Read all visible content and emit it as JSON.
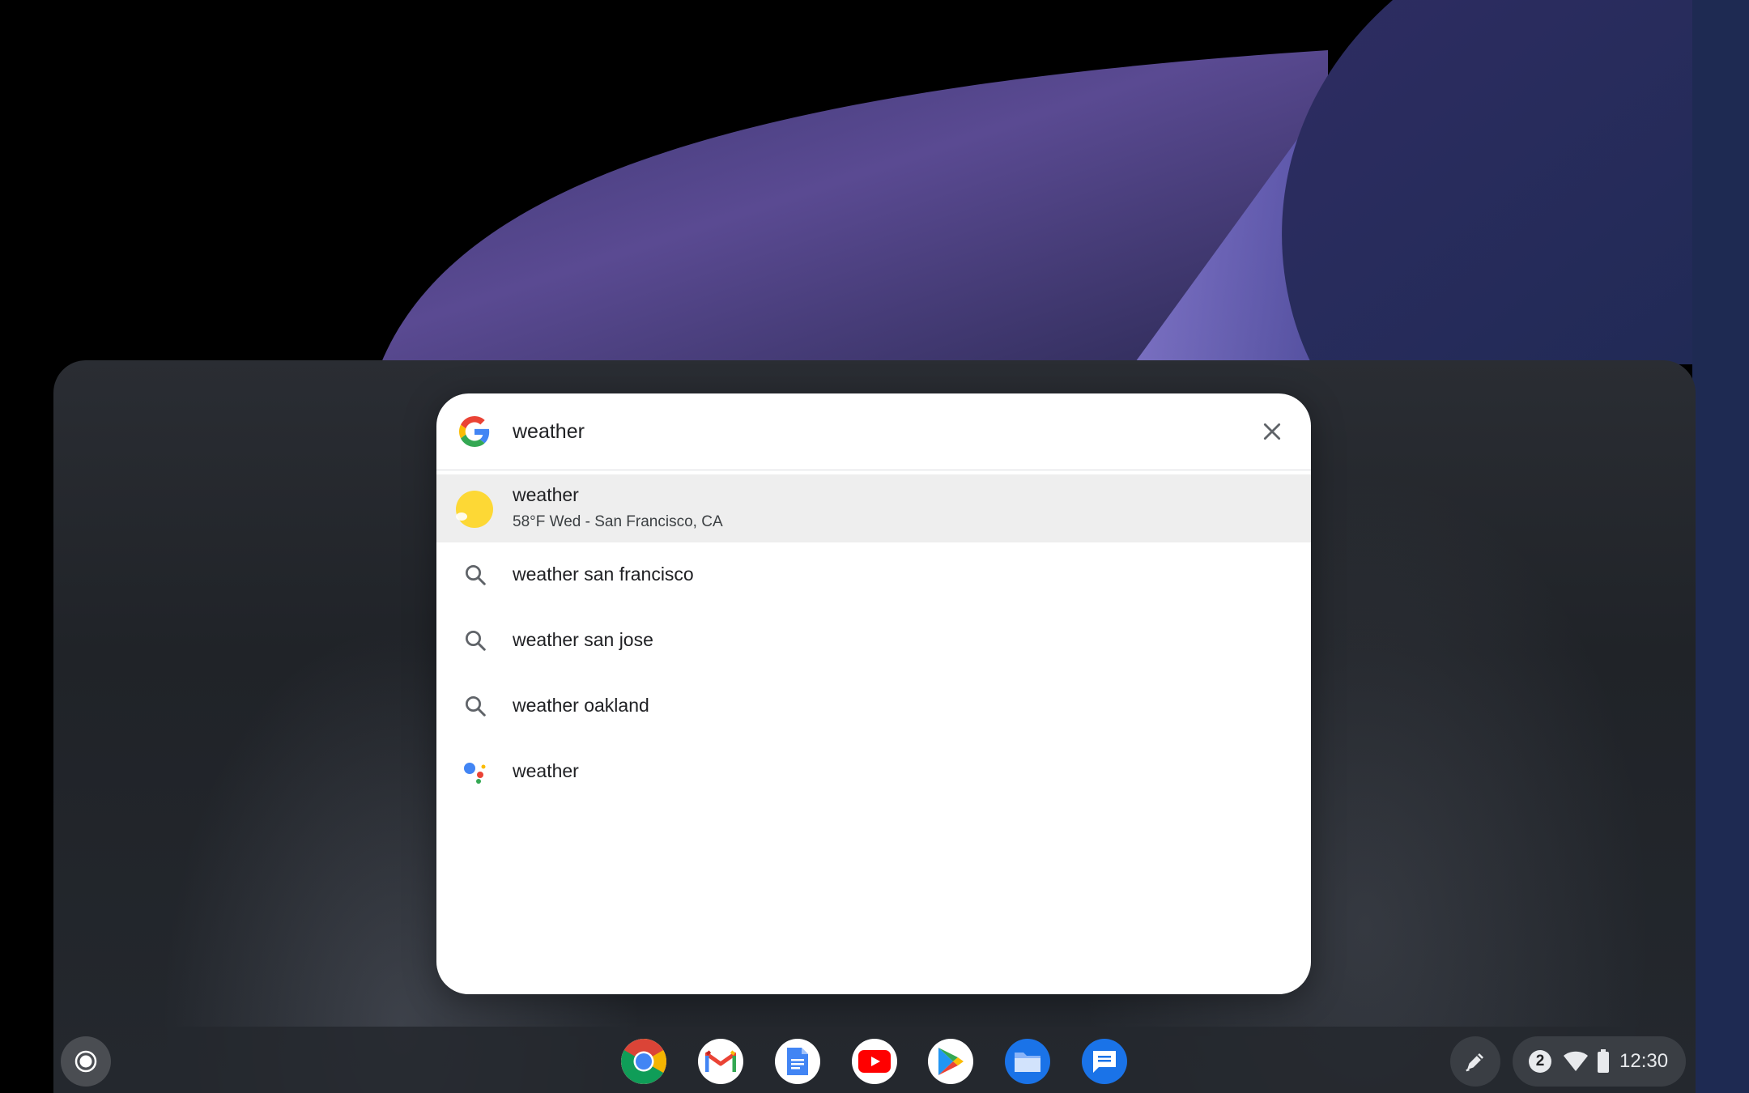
{
  "search": {
    "query": "weather",
    "logo_icon": "google-g-icon",
    "clear_icon": "close-icon"
  },
  "results": [
    {
      "title": "weather",
      "subtitle": "58°F Wed - San Francisco, CA",
      "icon": "weather-sun-icon",
      "highlighted": true
    },
    {
      "title": "weather san francisco",
      "icon": "search-icon"
    },
    {
      "title": "weather san jose",
      "icon": "search-icon"
    },
    {
      "title": "weather oakland",
      "icon": "search-icon"
    },
    {
      "title": "weather",
      "icon": "google-assistant-icon"
    }
  ],
  "shelf": {
    "apps": [
      "chrome-icon",
      "gmail-icon",
      "docs-icon",
      "youtube-icon",
      "play-store-icon",
      "files-icon",
      "messages-icon"
    ]
  },
  "tray": {
    "notification_count": "2",
    "time": "12:30"
  },
  "colors": {
    "google_blue": "#4285F4",
    "google_red": "#EA4335",
    "google_yellow": "#FBBC05",
    "google_green": "#34A853",
    "sun": "#FDD835"
  }
}
